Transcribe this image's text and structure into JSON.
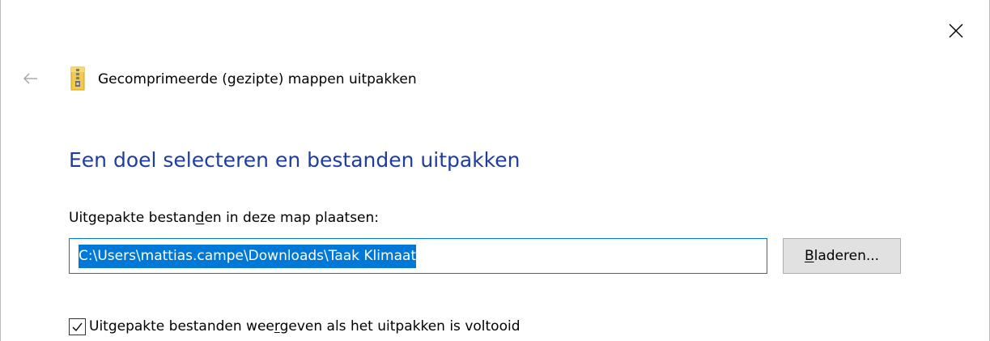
{
  "window": {
    "title": "Gecomprimeerde (gezipte) mappen uitpakken"
  },
  "main_instruction": "Een doel selecteren en bestanden uitpakken",
  "destination": {
    "label_pre": "Uitgepakte bestan",
    "label_accel": "d",
    "label_post": "en in deze map plaatsen:",
    "path_value": "C:\\Users\\mattias.campe\\Downloads\\Taak Klimaat"
  },
  "browse_button": {
    "accel": "B",
    "rest": "laderen..."
  },
  "show_files": {
    "checked": true,
    "label_pre": "Uitgepakte bestanden wee",
    "label_accel": "r",
    "label_post": "geven als het uitpakken is voltooid"
  },
  "colors": {
    "accent": "#0078d7",
    "instruction": "#1e3da0",
    "button_face": "#e1e1e1"
  },
  "icons": [
    "close-icon",
    "back-arrow-icon",
    "zip-folder-icon",
    "checkmark-icon"
  ]
}
